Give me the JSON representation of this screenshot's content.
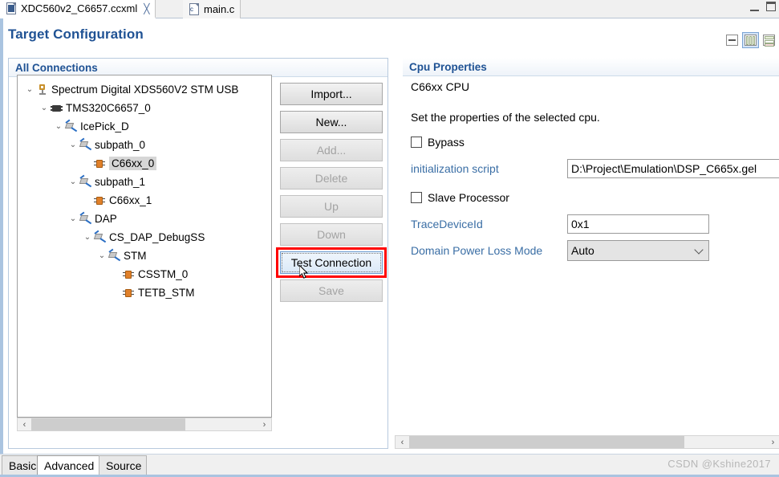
{
  "window": {
    "minimize_label": "minimize",
    "maximize_label": "maximize"
  },
  "tabs": [
    {
      "label": "XDC560v2_C6657.ccxml",
      "icon": "ccxml-file-icon",
      "active": true,
      "close": "╳"
    },
    {
      "label": "main.c",
      "icon": "c-file-icon",
      "active": false
    }
  ],
  "header": {
    "title": "Target Configuration",
    "layout_buttons": [
      {
        "name": "single-column-layout-icon",
        "selected": false
      },
      {
        "name": "two-column-layout-icon",
        "selected": true
      },
      {
        "name": "stacked-layout-icon",
        "selected": false
      }
    ]
  },
  "left_panel": {
    "title": "All Connections",
    "tree": [
      {
        "indent": 0,
        "twisty": "⌄",
        "icon": "probe-icon",
        "label": "Spectrum Digital XDS560V2 STM USB",
        "selected": false
      },
      {
        "indent": 1,
        "twisty": "⌄",
        "icon": "chip-icon",
        "label": "TMS320C6657_0",
        "selected": false
      },
      {
        "indent": 2,
        "twisty": "⌄",
        "icon": "connector-icon",
        "label": "IcePick_D",
        "selected": false
      },
      {
        "indent": 3,
        "twisty": "⌄",
        "icon": "connector-icon",
        "label": "subpath_0",
        "selected": false
      },
      {
        "indent": 4,
        "twisty": "",
        "icon": "cpu-icon",
        "label": "C66xx_0",
        "selected": true
      },
      {
        "indent": 3,
        "twisty": "⌄",
        "icon": "connector-icon",
        "label": "subpath_1",
        "selected": false
      },
      {
        "indent": 4,
        "twisty": "",
        "icon": "cpu-icon",
        "label": "C66xx_1",
        "selected": false
      },
      {
        "indent": 3,
        "twisty": "⌄",
        "icon": "connector-icon",
        "label": "DAP",
        "selected": false
      },
      {
        "indent": 4,
        "twisty": "⌄",
        "icon": "connector-icon",
        "label": "CS_DAP_DebugSS",
        "selected": false
      },
      {
        "indent": 5,
        "twisty": "⌄",
        "icon": "connector-icon",
        "label": "STM",
        "selected": false
      },
      {
        "indent": 6,
        "twisty": "",
        "icon": "cpu-icon",
        "label": "CSSTM_0",
        "selected": false
      },
      {
        "indent": 6,
        "twisty": "",
        "icon": "cpu-icon",
        "label": "TETB_STM",
        "selected": false
      }
    ],
    "buttons": [
      {
        "label": "Import...",
        "state": "enabled"
      },
      {
        "label": "New...",
        "state": "enabled"
      },
      {
        "label": "Add...",
        "state": "disabled"
      },
      {
        "label": "Delete",
        "state": "disabled"
      },
      {
        "label": "Up",
        "state": "disabled"
      },
      {
        "label": "Down",
        "state": "disabled"
      },
      {
        "label": "Test Connection",
        "state": "focused"
      },
      {
        "label": "Save",
        "state": "disabled"
      }
    ],
    "scroll": {
      "left_arrow": "‹",
      "right_arrow": "›"
    }
  },
  "right_panel": {
    "title": "Cpu Properties",
    "subtitle": "C66xx CPU",
    "description": "Set the properties of the selected cpu.",
    "fields": {
      "bypass_label": "Bypass",
      "bypass_checked": false,
      "init_script_label": "initialization script",
      "init_script_value": "D:\\Project\\Emulation\\DSP_C665x.gel",
      "slave_processor_label": "Slave Processor",
      "slave_processor_checked": false,
      "trace_device_id_label": "TraceDeviceId",
      "trace_device_id_value": "0x1",
      "domain_power_loss_label": "Domain Power Loss Mode",
      "domain_power_loss_value": "Auto"
    },
    "scroll": {
      "left_arrow": "‹",
      "right_arrow": "›"
    }
  },
  "bottom_tabs": [
    {
      "label": "Basic",
      "active": false
    },
    {
      "label": "Advanced",
      "active": true
    },
    {
      "label": "Source",
      "active": false
    }
  ],
  "watermark": "CSDN @Kshine2017",
  "colors": {
    "accent": "#1f5294",
    "link": "#3a6ea5",
    "highlight": "#ff0000",
    "selection": "#d6d6d6"
  }
}
